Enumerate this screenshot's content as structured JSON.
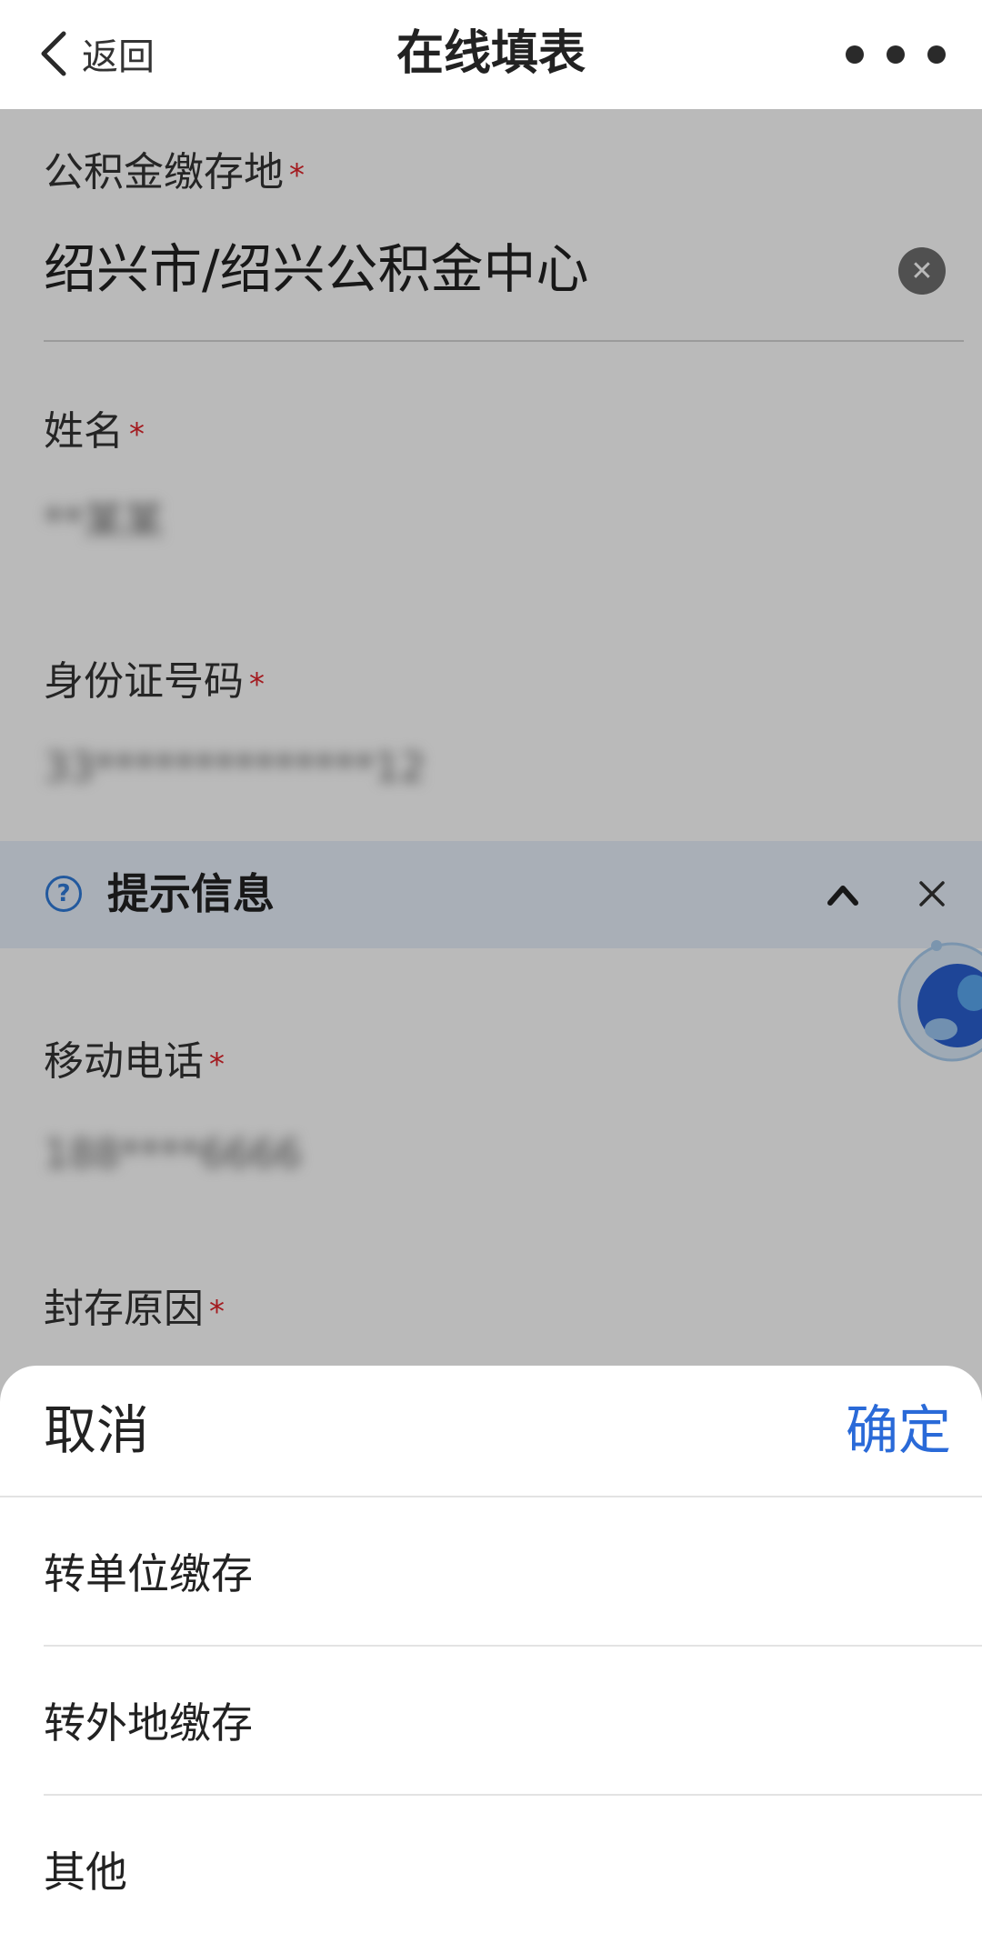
{
  "header": {
    "back_label": "返回",
    "title": "在线填表",
    "more_icon": "more-dots-icon"
  },
  "form": {
    "fields": [
      {
        "label": "公积金缴存地",
        "required_mark": "*",
        "value": "绍兴市/绍兴公积金中心"
      },
      {
        "label": "姓名",
        "required_mark": "*",
        "value": "**某某"
      },
      {
        "label": "身份证号码",
        "required_mark": "*",
        "value": "33**************12"
      },
      {
        "label": "移动电话",
        "required_mark": "*",
        "value": "188****6666"
      },
      {
        "label": "封存原因",
        "required_mark": "*",
        "value": ""
      }
    ]
  },
  "tip": {
    "text": "提示信息",
    "icon": "question-circle-icon",
    "collapse_icon": "chevron-up-icon",
    "close_icon": "close-icon"
  },
  "picker": {
    "cancel_label": "取消",
    "confirm_label": "确定",
    "options": [
      "转单位缴存",
      "转外地缴存",
      "其他"
    ]
  },
  "colors": {
    "required": "#e0242b",
    "accent": "#2a6ad8",
    "tip_bg": "#e8f0fb",
    "overlay": "rgba(0,0,0,0.27)"
  }
}
